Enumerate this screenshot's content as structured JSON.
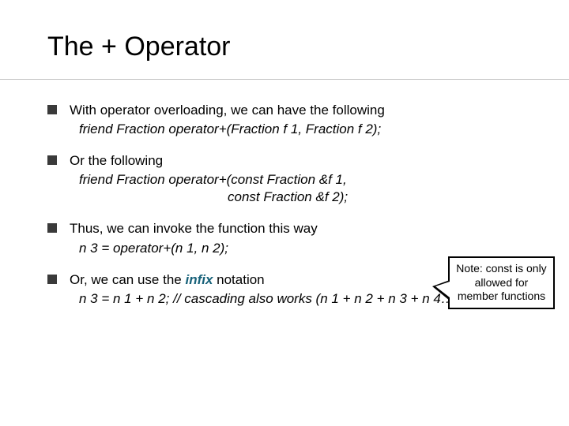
{
  "title": "The + Operator",
  "bullets": [
    {
      "text": "With operator overloading, we can have the following",
      "code_lines": [
        "friend Fraction operator+(Fraction f 1, Fraction f 2);"
      ]
    },
    {
      "text": "Or the following",
      "code_lines": [
        "friend Fraction operator+(const Fraction &f 1,",
        "const Fraction &f 2);"
      ],
      "second_line_indented": true
    },
    {
      "text": "Thus, we can invoke the function this way",
      "code_lines": [
        "n 3 = operator+(n 1, n 2);"
      ]
    },
    {
      "text_prefix": "Or, we can use the ",
      "emphasis": "infix",
      "text_suffix": " notation",
      "code_lines": [
        "n 3 = n 1 + n 2;  // cascading also works (n 1 + n 2 + n 3 + n 4…)"
      ]
    }
  ],
  "callout": "Note:  const is only allowed for member functions"
}
